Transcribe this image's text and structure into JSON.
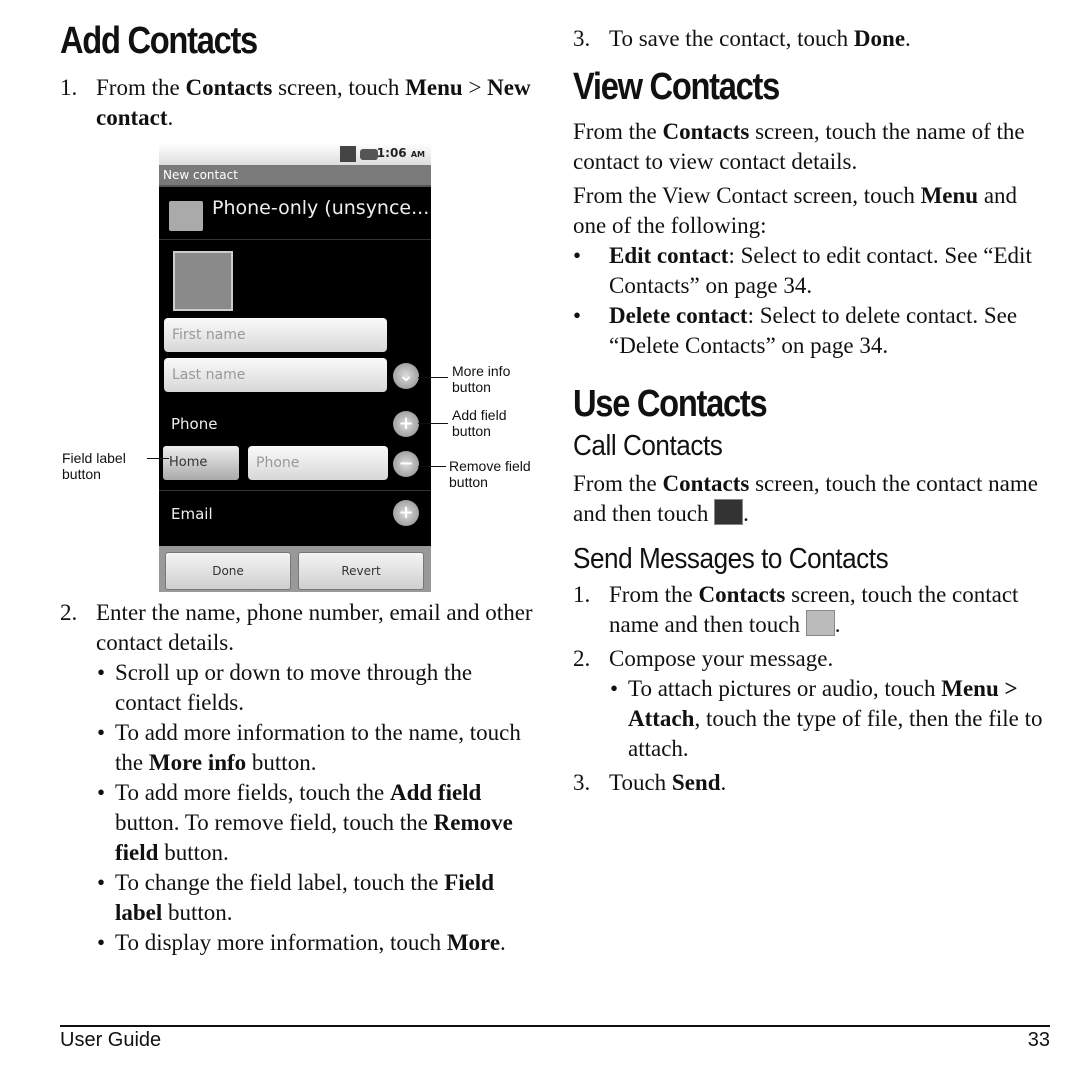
{
  "left": {
    "title": "Add Contacts",
    "step1": {
      "n": "1.",
      "pre": "From the ",
      "b1": "Contacts",
      "mid": " screen, touch ",
      "b2": "Menu",
      "gt": " > ",
      "b3": "New contact",
      "end": "."
    },
    "step2": {
      "n": "2.",
      "text": "Enter the name, phone number, email and other contact details."
    },
    "bullets": [
      {
        "pre": "Scroll up or down to move through the contact fields.",
        "bold": "",
        "post": ""
      },
      {
        "pre": "To add more information to the name, touch the ",
        "bold": "More info",
        "post": " button."
      },
      {
        "pre": "To add more fields, touch the ",
        "bold": "Add field",
        "post": " button. To remove field, touch the ",
        "bold2": "Remove field",
        "post2": " button."
      },
      {
        "pre": "To change the field label, touch the ",
        "bold": "Field label",
        "post": " button."
      },
      {
        "pre": "To display more information, touch ",
        "bold": "More",
        "post": "."
      }
    ]
  },
  "phone": {
    "time": "1:06",
    "ampm": "AM",
    "title": "New contact",
    "account": "Phone-only (unsynce...",
    "first_name_placeholder": "First name",
    "last_name_placeholder": "Last name",
    "phone_label": "Phone",
    "home_label": "Home",
    "phone_placeholder": "Phone",
    "email_label": "Email",
    "done": "Done",
    "revert": "Revert",
    "add_symbol": "+",
    "remove_symbol": "−",
    "more_symbol": "⌄"
  },
  "callouts": {
    "more_info": "More info button",
    "add_field": "Add field button",
    "remove_field": "Remove field button",
    "field_label": "Field label button"
  },
  "right": {
    "step3": {
      "n": "3.",
      "pre": "To save the contact, touch ",
      "bold": "Done",
      "end": "."
    },
    "view_title": "View Contacts",
    "view_p1": {
      "pre": "From the ",
      "bold": "Contacts",
      "post": " screen, touch the name of the contact to view contact details."
    },
    "view_p2": {
      "pre": "From the View Contact screen, touch ",
      "bold": "Menu",
      "post": " and one of the following:"
    },
    "view_bullets": [
      {
        "bold": "Edit contact",
        "post": ": Select to edit contact. See “Edit Contacts” on page 34."
      },
      {
        "bold": "Delete contact",
        "post": ": Select to delete contact. See “Delete Contacts” on page 34."
      }
    ],
    "use_title": "Use Contacts",
    "call_title": "Call Contacts",
    "call_p": {
      "pre": "From the ",
      "bold": "Contacts",
      "post": " screen, touch the contact name and then touch ",
      "end": "."
    },
    "send_title": "Send Messages to Contacts",
    "send_steps": [
      {
        "n": "1.",
        "pre": "From the ",
        "bold": "Contacts",
        "post": " screen, touch the contact name and then touch ",
        "end": "."
      },
      {
        "n": "2.",
        "pre": "Compose your message."
      },
      {
        "n": "3.",
        "pre": "Touch ",
        "bold": "Send",
        "end": "."
      }
    ],
    "send_sub": {
      "pre": "To attach pictures or audio, touch ",
      "b1": "Menu",
      "gt": " > ",
      "b2": "Attach",
      "post": ", touch the type of file, then the file to attach."
    }
  },
  "footer": {
    "left": "User Guide",
    "page": "33"
  }
}
